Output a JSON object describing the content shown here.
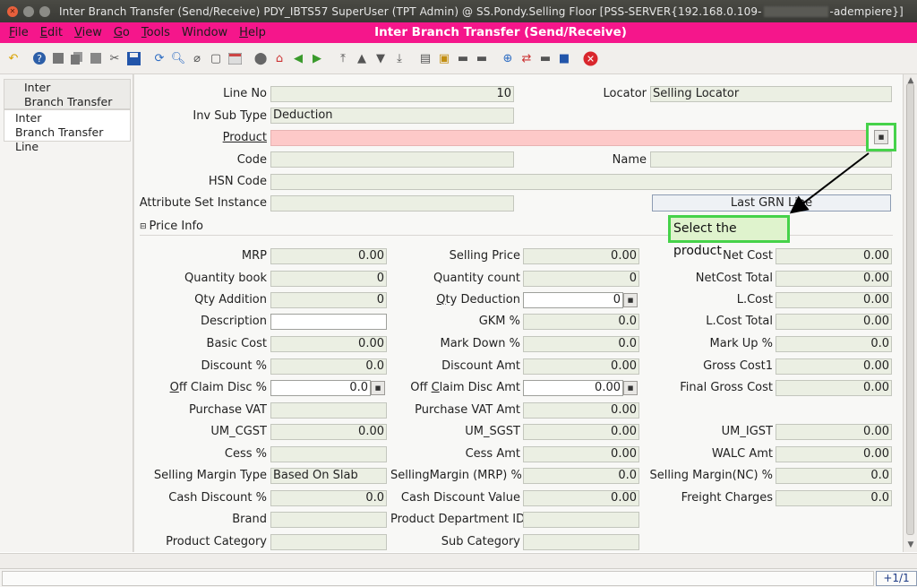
{
  "window": {
    "title_prefix": "Inter Branch Transfer (Send/Receive)  PDY_IBTS57  SuperUser (TPT Admin) @ SS.Pondy.Selling Floor [PSS-SERVER{192.168.0.109-",
    "title_suffix": "-adempiere}]"
  },
  "menu": {
    "items": [
      {
        "ul": "F",
        "rest": "ile"
      },
      {
        "ul": "E",
        "rest": "dit"
      },
      {
        "ul": "V",
        "rest": "iew"
      },
      {
        "ul": "G",
        "rest": "o"
      },
      {
        "ul": "T",
        "rest": "ools"
      },
      {
        "ul": "",
        "rest": "Window"
      },
      {
        "ul": "H",
        "rest": "elp"
      }
    ],
    "window_title": "Inter Branch Transfer (Send/Receive)"
  },
  "tabs": {
    "t1": [
      "Inter",
      "Branch Transfer"
    ],
    "t2": [
      "Inter",
      "Branch Transfer Line"
    ]
  },
  "form": {
    "line_no_label": "Line No",
    "line_no": "10",
    "locator_label": "Locator",
    "locator": "Selling Locator",
    "inv_sub_type_label": "Inv Sub Type",
    "inv_sub_type": "Deduction",
    "product_label": "Product",
    "product": "",
    "code_label": "Code",
    "name_label": "Name",
    "hsn_label": "HSN Code",
    "attr_label": "Attribute Set Instance",
    "last_grn_button": "Last GRN Line",
    "section_title": "Price Info",
    "mrp_label": "MRP",
    "mrp": "0.00",
    "selling_price_label": "Selling Price",
    "selling_price": "0.00",
    "net_cost_label": "Net Cost",
    "net_cost": "0.00",
    "qty_book_label": "Quantity book",
    "qty_book": "0",
    "qty_count_label": "Quantity count",
    "qty_count": "0",
    "netcost_total_label": "NetCost Total",
    "netcost_total": "0.00",
    "qty_add_label": "Qty Addition",
    "qty_add": "0",
    "qty_ded_label_ul": "Q",
    "qty_ded_label_rest": "ty Deduction",
    "qty_ded": "0",
    "lcost_label": "L.Cost",
    "lcost": "0.00",
    "desc_label": "Description",
    "desc": "",
    "gkm_label": "GKM %",
    "gkm": "0.0",
    "lcost_total_label": "L.Cost Total",
    "lcost_total": "0.00",
    "basic_cost_label": "Basic Cost",
    "basic_cost": "0.00",
    "markdown_label": "Mark Down %",
    "markdown": "0.0",
    "markup_label": "Mark Up %",
    "markup": "0.0",
    "disc_pct_label": "Discount %",
    "disc_pct": "0.0",
    "disc_amt_label": "Discount Amt",
    "disc_amt": "0.00",
    "gross_cost1_label": "Gross Cost1",
    "gross_cost1": "0.00",
    "off_claim_pct_label_ul": "O",
    "off_claim_pct_label_rest": "ff Claim Disc %",
    "off_claim_pct": "0.0",
    "off_claim_amt_label_a": "Off ",
    "off_claim_amt_label_ul": "C",
    "off_claim_amt_label_rest": "laim Disc Amt",
    "off_claim_amt": "0.00",
    "final_gross_label": "Final Gross Cost",
    "final_gross": "0.00",
    "purchase_vat_label": "Purchase VAT",
    "purchase_vat": "",
    "purchase_vat_amt_label": "Purchase VAT Amt",
    "purchase_vat_amt": "0.00",
    "um_cgst_label": "UM_CGST",
    "um_cgst": "0.00",
    "um_sgst_label": "UM_SGST",
    "um_sgst": "0.00",
    "um_igst_label": "UM_IGST",
    "um_igst": "0.00",
    "cess_pct_label": "Cess %",
    "cess_pct": "",
    "cess_amt_label": "Cess Amt",
    "cess_amt": "0.00",
    "walc_label": "WALC Amt",
    "walc": "0.00",
    "sm_type_label": "Selling Margin Type",
    "sm_type": "Based On Slab",
    "sm_mrp_label": "SellingMargin (MRP) %",
    "sm_mrp": "0.0",
    "sm_nc_label": "Selling Margin(NC) %",
    "sm_nc": "0.0",
    "cash_disc_label": "Cash Discount %",
    "cash_disc": "0.0",
    "cash_disc_val_label": "Cash Discount Value",
    "cash_disc_val": "0.00",
    "freight_label": "Freight Charges",
    "freight": "0.0",
    "brand_label": "Brand",
    "brand": "",
    "dept_label": "Product Department ID",
    "dept": "",
    "category_label": "Product Category",
    "category": "",
    "subcat_label": "Sub Category",
    "subcat": ""
  },
  "annotation": {
    "note": "Select the product"
  },
  "status": {
    "record": "+1/1"
  },
  "colors": {
    "menubar": "#f5168b",
    "mandatory": "#fdc9c8",
    "readonly": "#ebefe3",
    "annotation": "#46d24a"
  }
}
